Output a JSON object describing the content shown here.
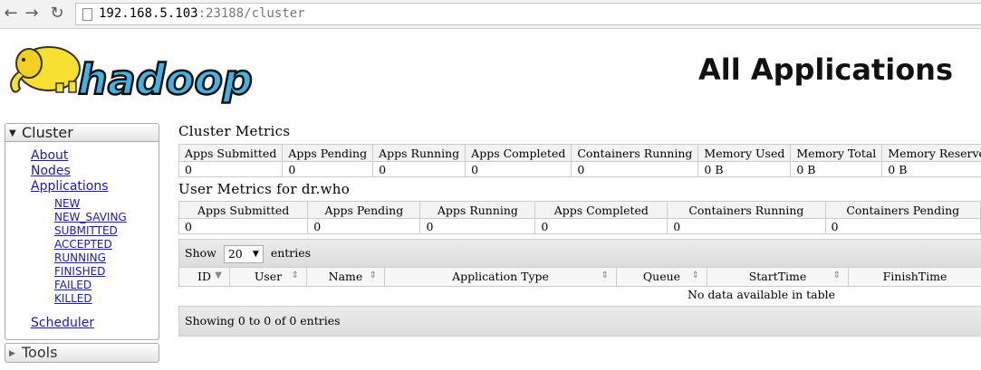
{
  "browser": {
    "back_icon": "back-arrow-icon",
    "forward_icon": "forward-arrow-icon",
    "reload_icon": "reload-icon",
    "url_host": "192.168.5.103",
    "url_rest": ":23188/cluster"
  },
  "header": {
    "logo_text": "hadoop",
    "title": "All Applications"
  },
  "sidebar": {
    "cluster_label": "Cluster",
    "links": [
      "About",
      "Nodes",
      "Applications"
    ],
    "app_states": [
      "NEW",
      "NEW_SAVING",
      "SUBMITTED",
      "ACCEPTED",
      "RUNNING",
      "FINISHED",
      "FAILED",
      "KILLED"
    ],
    "scheduler": "Scheduler",
    "tools_label": "Tools"
  },
  "cluster_metrics": {
    "title": "Cluster Metrics",
    "headers": [
      "Apps Submitted",
      "Apps Pending",
      "Apps Running",
      "Apps Completed",
      "Containers Running",
      "Memory Used",
      "Memory Total",
      "Memory Reserved"
    ],
    "values": [
      "0",
      "0",
      "0",
      "0",
      "0",
      "0 B",
      "0 B",
      "0 B"
    ]
  },
  "user_metrics": {
    "title": "User Metrics for dr.who",
    "headers": [
      "Apps Submitted",
      "Apps Pending",
      "Apps Running",
      "Apps Completed",
      "Containers Running",
      "Containers Pending"
    ],
    "values": [
      "0",
      "0",
      "0",
      "0",
      "0",
      "0"
    ]
  },
  "apps_table": {
    "show_label": "Show",
    "entries_value": "20",
    "entries_label": "entries",
    "columns": [
      "ID",
      "User",
      "Name",
      "Application Type",
      "Queue",
      "StartTime",
      "FinishTime"
    ],
    "empty_message": "No data available in table",
    "info": "Showing 0 to 0 of 0 entries"
  }
}
